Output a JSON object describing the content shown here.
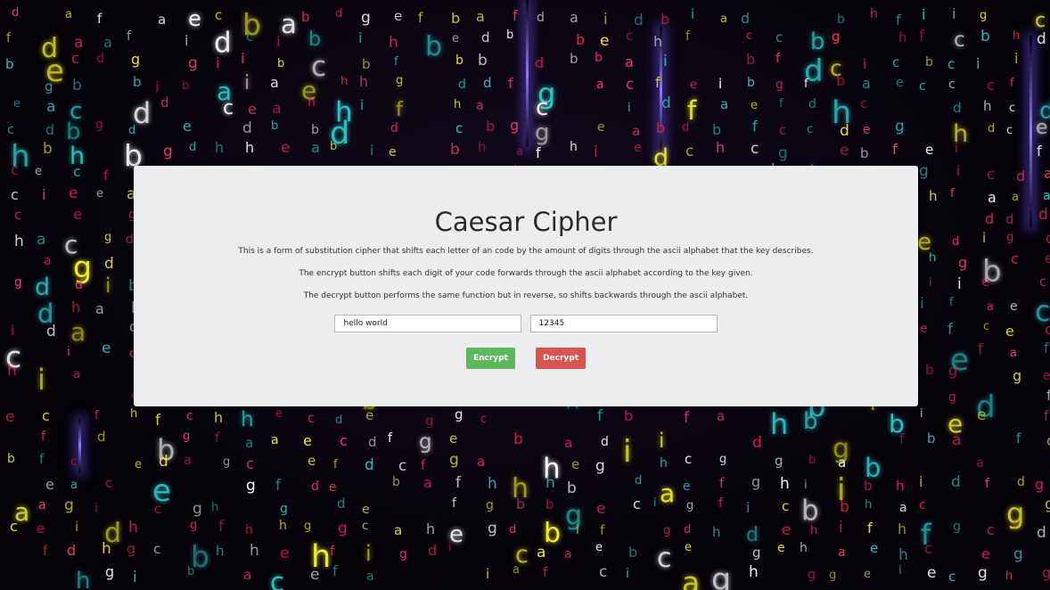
{
  "page": {
    "title": "Caesar Cipher",
    "descriptions": [
      "This is a form of substitution cipher that shifts each letter of an code by the amount of digits through the ascii alphabet that the key describes.",
      "The encrypt button shifts each digit of your code forwards through the ascii alphabet according to the key given.",
      "The decrypt button performs the same function but in reverse, so shifts backwards through the ascii alphabet."
    ],
    "inputs": {
      "message": "hello world",
      "key": "12345"
    },
    "buttons": {
      "encrypt": "Encrypt",
      "decrypt": "Decrypt"
    }
  },
  "background": {
    "letters": "abcdefghi",
    "colors": [
      "#e0224f",
      "#ff3a6a",
      "#2ec4c4",
      "#f2ef2a",
      "#ffffff"
    ]
  }
}
